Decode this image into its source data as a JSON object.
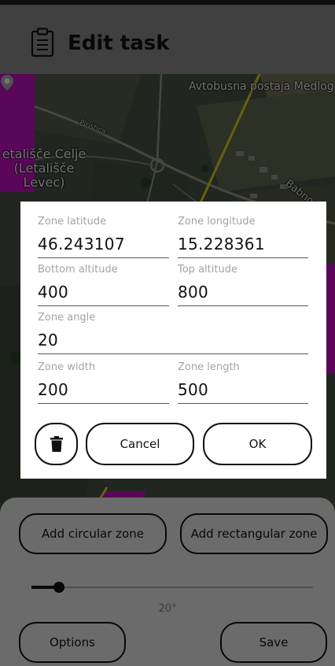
{
  "header": {
    "title": "Edit task",
    "icon": "clipboard-icon"
  },
  "map": {
    "airport_label": "etališče Celje (Letališče Levec)",
    "bus_stop_label": "Avtobusna postaja Medlog",
    "street_label_1": "Piristica",
    "street_label_2": "Babno",
    "zone_color": "#b40fb4",
    "route_color": "#c8c21e"
  },
  "dialog": {
    "fields": {
      "zone_latitude": {
        "label": "Zone latitude",
        "value": "46.243107"
      },
      "zone_longitude": {
        "label": "Zone longitude",
        "value": "15.228361"
      },
      "bottom_altitude": {
        "label": "Bottom altitude",
        "value": "400"
      },
      "top_altitude": {
        "label": "Top altitude",
        "value": "800"
      },
      "zone_angle": {
        "label": "Zone angle",
        "value": "20"
      },
      "zone_width": {
        "label": "Zone width",
        "value": "200"
      },
      "zone_length": {
        "label": "Zone length",
        "value": "500"
      }
    },
    "delete_icon": "trash-icon",
    "cancel_label": "Cancel",
    "ok_label": "OK"
  },
  "panel": {
    "add_circular_label": "Add circular zone",
    "add_rectangular_label": "Add rectangular zone",
    "angle_slider_fraction": 0.06,
    "angle_readout": "20°",
    "options_label": "Options",
    "save_label": "Save"
  }
}
